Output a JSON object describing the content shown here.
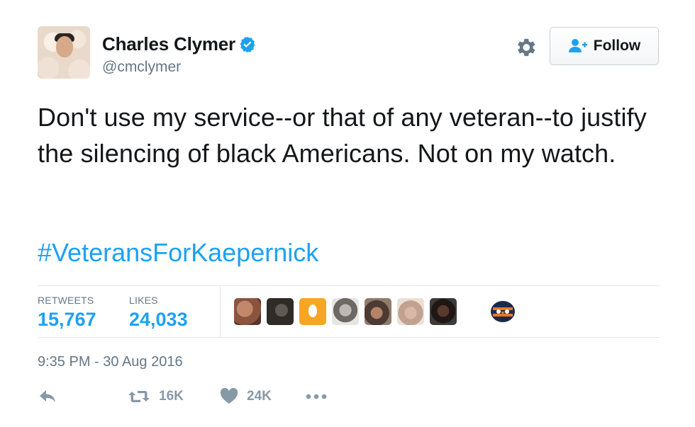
{
  "author": {
    "name": "Charles Clymer",
    "handle": "@cmclymer",
    "verified": true
  },
  "header": {
    "follow_label": "Follow"
  },
  "tweet": {
    "text": "Don't use my service--or that of any veteran--to justify the silencing of black Americans. Not on my watch.",
    "hashtag": "#VeteransForKaepernick",
    "timestamp": "9:35 PM - 30 Aug 2016"
  },
  "stats": {
    "retweets_label": "RETWEETS",
    "retweets_value": "15,767",
    "likes_label": "LIKES",
    "likes_value": "24,033"
  },
  "actions": {
    "retweet_count": "16K",
    "like_count": "24K"
  },
  "colors": {
    "accent": "#1da1f2",
    "secondary_text": "#657786",
    "icon_gray": "#8899a6"
  },
  "icons": {
    "verified": "verified-badge-icon",
    "gear": "gear-icon",
    "follow": "add-user-icon",
    "reply": "reply-icon",
    "retweet": "retweet-icon",
    "like": "heart-icon",
    "more": "more-icon"
  }
}
